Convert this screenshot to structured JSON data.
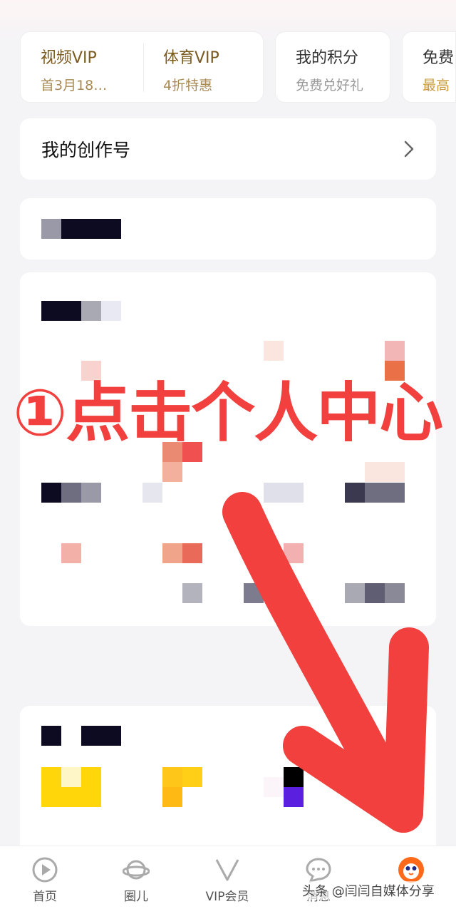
{
  "vip_cards": [
    {
      "title": "视频VIP",
      "sub": "首3月18…"
    },
    {
      "title": "体育VIP",
      "sub": "4折特惠"
    },
    {
      "title": "我的积分",
      "sub": "免费兑好礼"
    },
    {
      "title": "免费",
      "sub": "最高"
    }
  ],
  "creator": {
    "label": "我的创作号"
  },
  "overlay": {
    "instruction": "①点击个人中心",
    "color": "#f1403d"
  },
  "nav": [
    {
      "label": "首页",
      "icon": "play-icon"
    },
    {
      "label": "圈儿",
      "icon": "planet-icon"
    },
    {
      "label": "VIP会员",
      "icon": "vip-v-icon"
    },
    {
      "label": "消息",
      "icon": "message-icon"
    },
    {
      "label": "",
      "icon": "profile-avatar-icon"
    }
  ],
  "watermark": "头条 @闫闫自媒体分享"
}
